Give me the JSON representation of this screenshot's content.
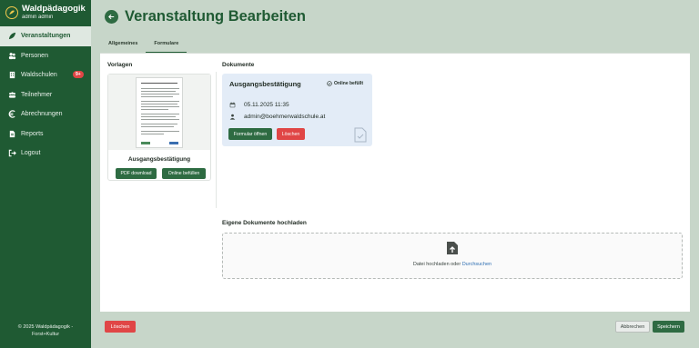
{
  "brand": {
    "title": "Waldpädagogik",
    "user": "admin admin"
  },
  "sidebar": {
    "items": [
      {
        "label": "Veranstaltungen",
        "icon": "leaf-icon",
        "active": true
      },
      {
        "label": "Personen",
        "icon": "people-icon"
      },
      {
        "label": "Waldschulen",
        "icon": "building-icon",
        "badge": "9+"
      },
      {
        "label": "Teilnehmer",
        "icon": "users-icon"
      },
      {
        "label": "Abrechnungen",
        "icon": "euro-icon"
      },
      {
        "label": "Reports",
        "icon": "document-icon"
      },
      {
        "label": "Logout",
        "icon": "logout-icon"
      }
    ],
    "footer_line1": "© 2025 Waldpädagogik -",
    "footer_line2": "Forst+Kultur"
  },
  "header": {
    "title": "Veranstaltung Bearbeiten"
  },
  "tabs": [
    {
      "label": "Allgemeines"
    },
    {
      "label": "Formulare",
      "active": true
    }
  ],
  "vorlagen": {
    "label": "Vorlagen",
    "card": {
      "title": "Ausgangsbestätigung",
      "pdf_button": "PDF download",
      "fill_button": "Online befüllen"
    }
  },
  "dokumente": {
    "label": "Dokumente",
    "card": {
      "title": "Ausgangsbestätigung",
      "status": "Online befüllt",
      "date": "05.11.2025 11:35",
      "user": "admin@boehmerwaldschule.at",
      "open_button": "Formular öffnen",
      "delete_button": "Löschen"
    }
  },
  "upload": {
    "label": "Eigene Dokumente hochladen",
    "text": "Datei hochladen oder ",
    "link": "Durchsuchen"
  },
  "footer_bar": {
    "delete": "Löschen",
    "cancel": "Abbrechen",
    "save": "Speichern"
  },
  "colors": {
    "primary": "#1f5a33",
    "accent": "#2e6b42",
    "danger": "#e04646",
    "link": "#2f6fb2"
  }
}
